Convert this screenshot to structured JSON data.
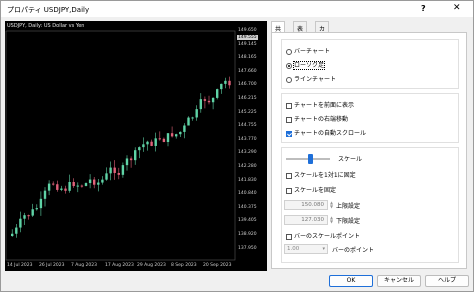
{
  "window": {
    "title": "プロパティ USDJPY,Daily",
    "help": "?",
    "close": "✕"
  },
  "chart": {
    "title": "USDJPY, Daily:  US Dollar vs Yen",
    "current_price": "149.555",
    "price_labels": [
      "149.650",
      "149.145",
      "148.165",
      "147.660",
      "146.700",
      "146.215",
      "145.225",
      "144.755",
      "143.770",
      "143.290",
      "142.280",
      "141.830",
      "140.840",
      "140.375",
      "139.405",
      "138.920",
      "137.950"
    ],
    "date_labels": [
      "14 Jul 2023",
      "26 Jul 2023",
      "7 Aug 2023",
      "17 Aug 2023",
      "29 Aug 2023",
      "8 Sep 2023",
      "20 Sep 2023"
    ],
    "colors": {
      "bull": "#5fd3a6",
      "bear": "#e0627a",
      "background": "#000000",
      "grid": "#3a3a3a"
    }
  },
  "tabs": [
    {
      "label": "共有",
      "active": true
    },
    {
      "label": "表示",
      "active": false
    },
    {
      "label": "カラー",
      "active": false
    }
  ],
  "chart_type": {
    "options": [
      {
        "label": "バーチャート",
        "selected": false
      },
      {
        "label": "ローソク足",
        "selected": true
      },
      {
        "label": "ラインチャート",
        "selected": false
      }
    ]
  },
  "display_options": [
    {
      "label": "チャートを前面に表示",
      "checked": false
    },
    {
      "label": "チャートの右端移動",
      "checked": false
    },
    {
      "label": "チャートの自動スクロール",
      "checked": true
    }
  ],
  "scale": {
    "label": "スケール",
    "one_to_one": {
      "label": "スケールを1対1に固定",
      "checked": false
    },
    "fixed": {
      "label": "スケールを固定",
      "checked": false
    },
    "upper_value": "150.080",
    "upper_label": "上限設定",
    "lower_value": "127.030",
    "lower_label": "下限設定",
    "bar_points": {
      "label": "バーのスケールポイント",
      "checked": false
    },
    "bar_points_value": "1.00",
    "bar_points_unit": "バーのポイント"
  },
  "buttons": {
    "ok": "OK",
    "cancel": "キャンセル",
    "help": "ヘルプ"
  }
}
